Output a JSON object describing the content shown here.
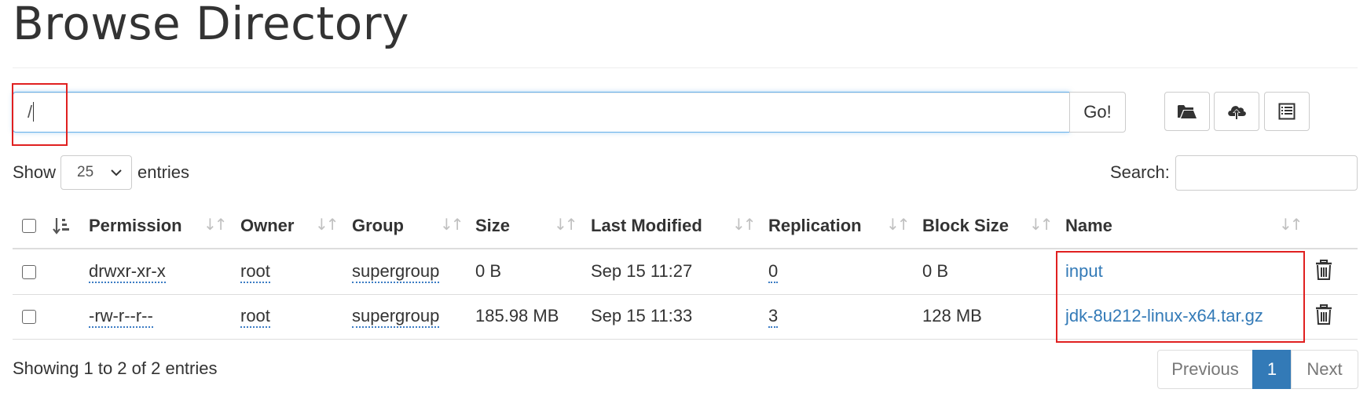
{
  "page": {
    "title": "Browse Directory"
  },
  "path_bar": {
    "value": "/",
    "go_label": "Go!"
  },
  "toolbar": {
    "icons": [
      "folder-open-icon",
      "cloud-upload-icon",
      "list-icon"
    ]
  },
  "table_controls": {
    "show_label": "Show",
    "entries_value": "25",
    "entries_label": "entries",
    "search_label": "Search:",
    "search_value": ""
  },
  "table": {
    "headers": [
      "Permission",
      "Owner",
      "Group",
      "Size",
      "Last Modified",
      "Replication",
      "Block Size",
      "Name"
    ],
    "rows": [
      {
        "permission": "drwxr-xr-x",
        "owner": "root",
        "group": "supergroup",
        "size": "0 B",
        "last_modified": "Sep 15 11:27",
        "replication": "0",
        "block_size": "0 B",
        "name": "input"
      },
      {
        "permission": "-rw-r--r--",
        "owner": "root",
        "group": "supergroup",
        "size": "185.98 MB",
        "last_modified": "Sep 15 11:33",
        "replication": "3",
        "block_size": "128 MB",
        "name": "jdk-8u212-linux-x64.tar.gz"
      }
    ]
  },
  "footer": {
    "info": "Showing 1 to 2 of 2 entries",
    "prev_label": "Previous",
    "current_page": "1",
    "next_label": "Next"
  },
  "colors": {
    "link": "#337ab7",
    "active_page": "#337ab7",
    "highlight_box": "#e02020"
  }
}
